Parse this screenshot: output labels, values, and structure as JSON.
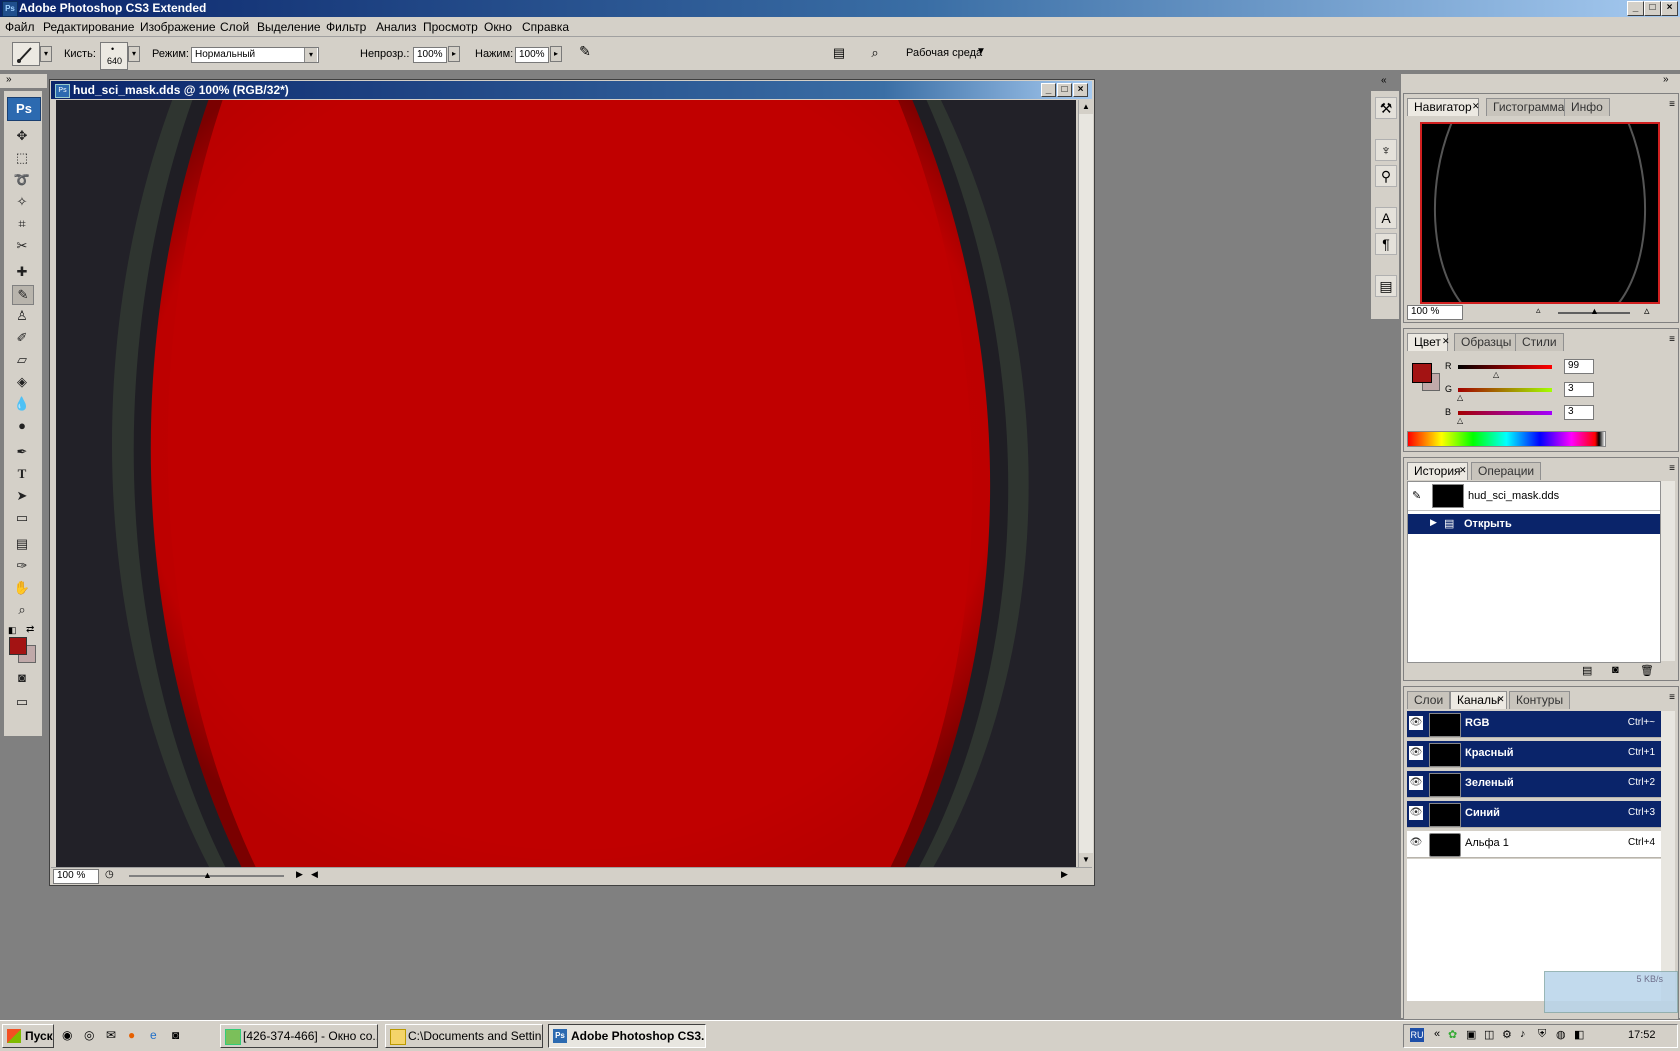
{
  "app": {
    "title": "Adobe Photoshop CS3 Extended",
    "window_buttons": [
      "_",
      "□",
      "×"
    ]
  },
  "menu": [
    "Файл",
    "Редактирование",
    "Изображение",
    "Слой",
    "Выделение",
    "Фильтр",
    "Анализ",
    "Просмотр",
    "Окно",
    "Справка"
  ],
  "options_bar": {
    "brush_label": "Кисть:",
    "brush_size": "640",
    "mode_label": "Режим:",
    "mode_value": "Нормальный",
    "opacity_label": "Непрозр.:",
    "opacity_value": "100%",
    "flow_label": "Нажим:",
    "flow_value": "100%",
    "workspace_label": "Рабочая среда"
  },
  "document": {
    "title": "hud_sci_mask.dds @ 100% (RGB/32*)",
    "zoom": "100 %",
    "canvas_colors": {
      "background": "#222128",
      "ring": "#2f3530",
      "fill": "#c00000"
    }
  },
  "navigator_panel": {
    "tabs": [
      "Навигатор",
      "Гистограмма",
      "Инфо"
    ],
    "zoom": "100 %"
  },
  "color_panel": {
    "tabs": [
      "Цвет",
      "Образцы",
      "Стили"
    ],
    "channels": [
      {
        "label": "R",
        "value": "99"
      },
      {
        "label": "G",
        "value": "3"
      },
      {
        "label": "B",
        "value": "3"
      }
    ],
    "foreground": "#a31313",
    "background": "#c0a9a9"
  },
  "history_panel": {
    "tabs": [
      "История",
      "Операции"
    ],
    "snapshot": "hud_sci_mask.dds",
    "steps": [
      "Открыть"
    ]
  },
  "channels_panel": {
    "tabs": [
      "Слои",
      "Каналы",
      "Контуры"
    ],
    "channels": [
      {
        "name": "RGB",
        "shortcut": "Ctrl+~",
        "selected": true
      },
      {
        "name": "Красный",
        "shortcut": "Ctrl+1",
        "selected": true
      },
      {
        "name": "Зеленый",
        "shortcut": "Ctrl+2",
        "selected": true
      },
      {
        "name": "Синий",
        "shortcut": "Ctrl+3",
        "selected": true
      },
      {
        "name": "Альфа 1",
        "shortcut": "Ctrl+4",
        "selected": false
      }
    ]
  },
  "network_widget": {
    "speed": "5 KB/s"
  },
  "taskbar": {
    "start": "Пуск",
    "buttons": [
      "[426-374-466] - Окно со...",
      "C:\\Documents and Settin...",
      "Adobe Photoshop CS3..."
    ],
    "lang": "RU",
    "time": "17:52"
  }
}
